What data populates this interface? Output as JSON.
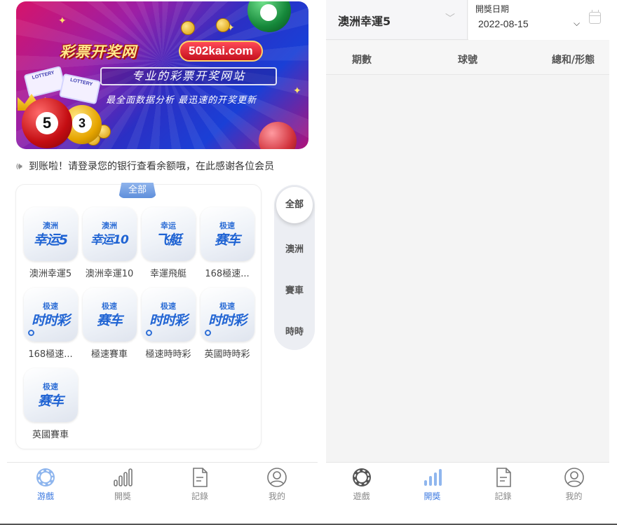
{
  "left": {
    "banner": {
      "title": "彩票开奖网",
      "url": "502kai.com",
      "subtitle": "专业的彩票开奖网站",
      "tagline": "最全面数据分析   最迅速的开奖更新",
      "ticket_text": "LOTTERY",
      "ball_numbers": [
        "5",
        "3"
      ]
    },
    "notice": {
      "icon": "speaker-icon",
      "text": "到账啦！请登录您的银行查看余额哦，在此感谢各位会员"
    },
    "category_tag": "全部",
    "games": [
      {
        "name": "澳洲幸運5",
        "icon_small": "澳洲",
        "icon_big": "幸运5"
      },
      {
        "name": "澳洲幸運10",
        "icon_small": "澳洲",
        "icon_big": "幸运10"
      },
      {
        "name": "幸運飛艇",
        "icon_small": "幸运",
        "icon_big": "飞艇"
      },
      {
        "name": "168極速...",
        "icon_small": "极速",
        "icon_big": "赛车"
      },
      {
        "name": "168極速...",
        "icon_small": "极速",
        "icon_big": "时时彩"
      },
      {
        "name": "極速賽車",
        "icon_small": "极速",
        "icon_big": "赛车"
      },
      {
        "name": "極速時時彩",
        "icon_small": "极速",
        "icon_big": "时时彩"
      },
      {
        "name": "英國時時彩",
        "icon_small": "极速",
        "icon_big": "时时彩"
      },
      {
        "name": "英國賽車",
        "icon_small": "极速",
        "icon_big": "赛车"
      }
    ],
    "categories": [
      "全部",
      "澳洲",
      "賽車",
      "時時"
    ],
    "active_category": "全部",
    "tabs": [
      {
        "label": "游戲",
        "icon": "games-icon",
        "active": true
      },
      {
        "label": "開獎",
        "icon": "chart-icon",
        "active": false
      },
      {
        "label": "記錄",
        "icon": "document-icon",
        "active": false
      },
      {
        "label": "我的",
        "icon": "user-icon",
        "active": false
      }
    ]
  },
  "right": {
    "game_select": {
      "value": "澳洲幸運5"
    },
    "date": {
      "label": "開獎日期",
      "value": "2022-08-15"
    },
    "columns": [
      "期數",
      "球號",
      "總和/形態"
    ],
    "tabs": [
      {
        "label": "遊戲",
        "icon": "games-icon",
        "active": false
      },
      {
        "label": "開獎",
        "icon": "chart-icon",
        "active": true
      },
      {
        "label": "記錄",
        "icon": "document-icon",
        "active": false
      },
      {
        "label": "我的",
        "icon": "user-icon",
        "active": false
      }
    ]
  },
  "colors": {
    "accent": "#3b78e0",
    "inactive": "#888888"
  }
}
